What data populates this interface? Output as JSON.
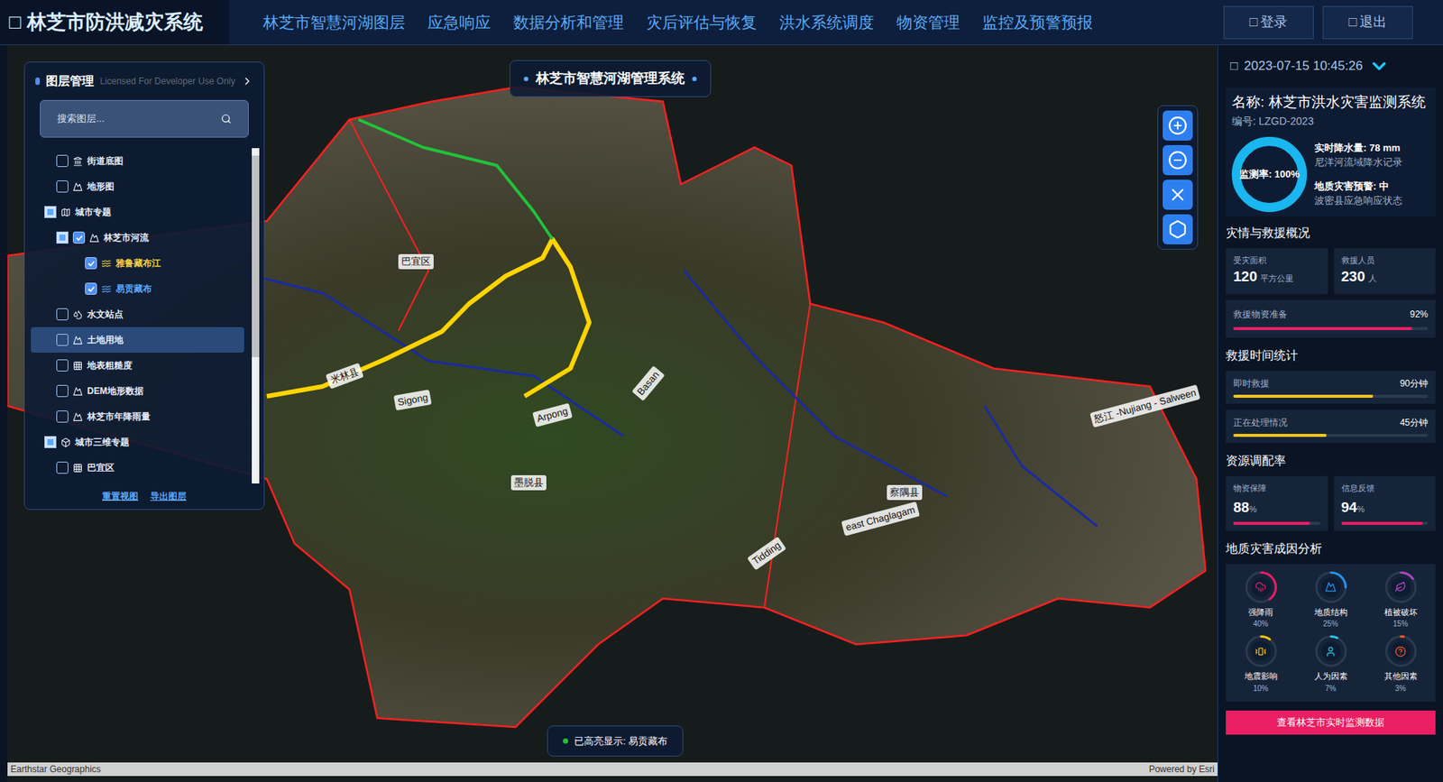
{
  "header": {
    "icon": "□",
    "title": "林芝市防洪减灾系统",
    "nav": [
      {
        "label": "林芝市智慧河湖图层",
        "selected": false
      },
      {
        "label": "应急响应",
        "selected": false
      },
      {
        "label": "数据分析和管理",
        "selected": false
      },
      {
        "label": "灾后评估与恢复",
        "selected": false
      },
      {
        "label": "洪水系统调度",
        "selected": false
      },
      {
        "label": "物资管理",
        "selected": false
      },
      {
        "label": "监控及预警预报",
        "selected": false
      }
    ],
    "buttons": [
      {
        "icon": "□",
        "label": "登录"
      },
      {
        "icon": "□",
        "label": "退出"
      }
    ]
  },
  "map": {
    "title_badge": "林芝市智慧河湖管理系统",
    "toast": "已高亮显示: 易贡藏布",
    "attribution_left": "Earthstar Geographics",
    "attribution_right": "Powered by Esri",
    "labels": [
      "巴宜区",
      "米林县",
      "墨脱县",
      "察隅县",
      "Arpong",
      "Basan",
      "Sigong",
      "Tidding",
      "east Chaglagam",
      "怒江 -Nujiang - Salween"
    ]
  },
  "layer_panel": {
    "title": "图层管理",
    "watermark": "Licensed For Developer Use Only",
    "search_placeholder": "搜索图层...",
    "items": [
      {
        "label": "街道底图",
        "kind": "layer",
        "depth": 1,
        "checked": false,
        "selected": false,
        "icon": "street"
      },
      {
        "label": "地形图",
        "kind": "layer",
        "depth": 1,
        "checked": false,
        "selected": false,
        "icon": "terrain"
      },
      {
        "label": "城市专题",
        "kind": "group",
        "depth": 0,
        "checked": false,
        "expanded": true,
        "selected": false,
        "icon": "city"
      },
      {
        "label": "林芝市河流",
        "kind": "subgroup",
        "depth": 1,
        "checked": true,
        "expanded": true,
        "selected": false,
        "icon": "terrain"
      },
      {
        "label": "雅鲁藏布江",
        "kind": "layer",
        "depth": 2,
        "checked": true,
        "selected": false,
        "icon": "river",
        "color": "#f5d142"
      },
      {
        "label": "易贡藏布",
        "kind": "layer",
        "depth": 2,
        "checked": true,
        "selected": false,
        "icon": "river",
        "color": "#5aa9ff"
      },
      {
        "label": "水文站点",
        "kind": "layer",
        "depth": 1,
        "checked": false,
        "selected": false,
        "icon": "station"
      },
      {
        "label": "土地用地",
        "kind": "layer",
        "depth": 1,
        "checked": false,
        "selected": true,
        "icon": "terrain"
      },
      {
        "label": "地表粗糙度",
        "kind": "layer",
        "depth": 1,
        "checked": false,
        "selected": false,
        "icon": "grid"
      },
      {
        "label": "DEM地形数据",
        "kind": "layer",
        "depth": 1,
        "checked": false,
        "selected": false,
        "icon": "terrain"
      },
      {
        "label": "林芝市年降雨量",
        "kind": "layer",
        "depth": 1,
        "checked": false,
        "selected": false,
        "icon": "terrain"
      },
      {
        "label": "城市三维专题",
        "kind": "group",
        "depth": 0,
        "checked": false,
        "expanded": true,
        "selected": false,
        "icon": "box"
      },
      {
        "label": "巴宜区",
        "kind": "layer",
        "depth": 1,
        "checked": false,
        "selected": false,
        "icon": "grid"
      }
    ],
    "buttons": [
      "重置视图",
      "导出图层"
    ]
  },
  "panel": {
    "icon": "□",
    "datetime": "2023-07-15 10:45:26",
    "name": "名称: 林芝市洪水灾害监测系统",
    "code": "编号: LZGD-2023",
    "gauge": {
      "label": "监测率: 100%",
      "level": 1.0
    },
    "info": [
      {
        "title": "实时降水量: 78 mm",
        "sub": "尼洋河流域降水记录"
      },
      {
        "title": "地质灾害预警: 中",
        "sub": "波密县应急响应状态"
      }
    ],
    "sections": {
      "overview": "灾情与救援概况",
      "time": "救援时间统计",
      "resource": "资源调配率",
      "cause": "地质灾害成因分析"
    },
    "overview_cards": [
      {
        "label": "受灾面积",
        "value": "120",
        "unit": "平方公里"
      },
      {
        "label": "救援人员",
        "value": "230",
        "unit": "人"
      }
    ],
    "overview_bar": {
      "label": "救援物资准备",
      "reading": "92%",
      "level": 0.92,
      "color": "#e91e63"
    },
    "time_bars": [
      {
        "label": "即时救援",
        "reading": "90分钟",
        "level": 0.72,
        "color": "#f5c518"
      },
      {
        "label": "正在处理情况",
        "reading": "45分钟",
        "level": 0.48,
        "color": "#f5c518"
      }
    ],
    "resource_cards": [
      {
        "label": "物资保障",
        "value": "88",
        "unit": "%",
        "level": 0.88,
        "color": "#e91e63"
      },
      {
        "label": "信息反馈",
        "value": "94",
        "unit": "%",
        "level": 0.94,
        "color": "#e91e63"
      }
    ],
    "causes": [
      {
        "label": "强降雨",
        "reading": "40%",
        "level": 0.4,
        "color": "#e91e63",
        "icon": "rain"
      },
      {
        "label": "地质结构",
        "reading": "25%",
        "level": 0.25,
        "color": "#2196f3",
        "icon": "mountain"
      },
      {
        "label": "植被破坏",
        "reading": "15%",
        "level": 0.15,
        "color": "#ab47bc",
        "icon": "leaf"
      },
      {
        "label": "地震影响",
        "reading": "10%",
        "level": 0.1,
        "color": "#ffc107",
        "icon": "quake"
      },
      {
        "label": "人为因素",
        "reading": "7%",
        "level": 0.07,
        "color": "#26c6da",
        "icon": "user"
      },
      {
        "label": "其他因素",
        "reading": "3%",
        "level": 0.03,
        "color": "#ff5722",
        "icon": "other"
      }
    ],
    "action_button": "查看林芝市实时监测数据"
  }
}
